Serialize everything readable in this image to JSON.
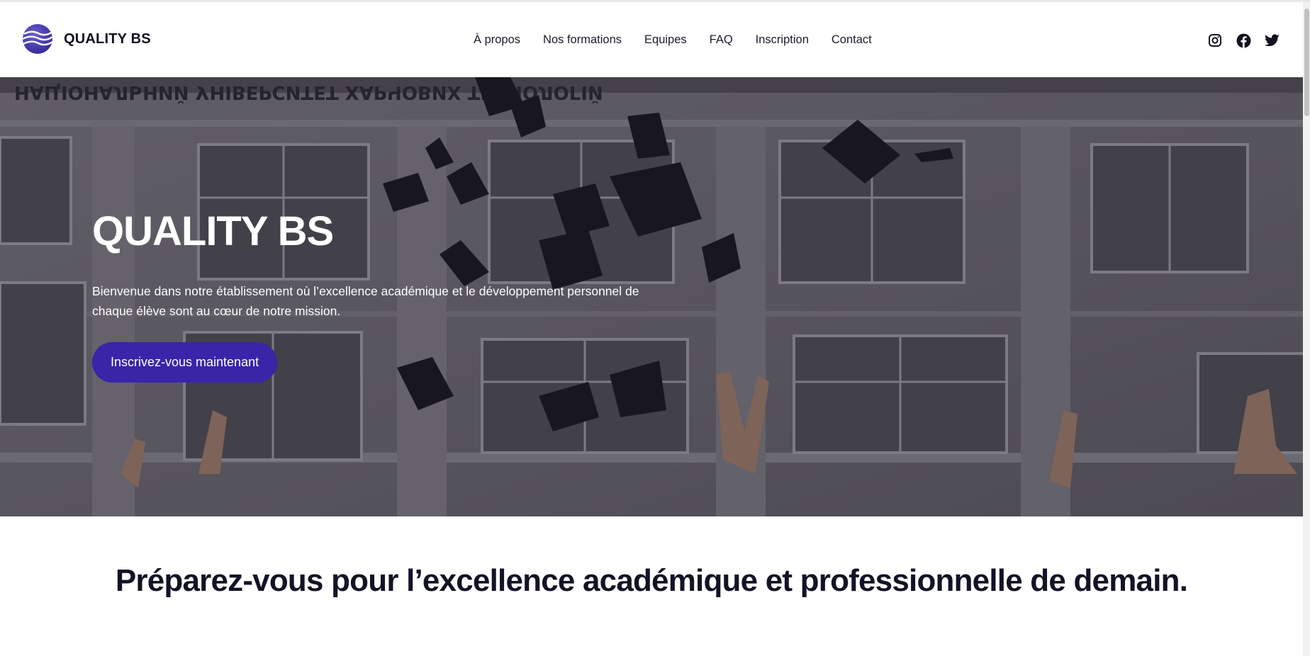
{
  "header": {
    "brand_name": "QUALITY BS",
    "nav": [
      {
        "label": "À propos"
      },
      {
        "label": "Nos formations"
      },
      {
        "label": "Equipes"
      },
      {
        "label": "FAQ"
      },
      {
        "label": "Inscription"
      },
      {
        "label": "Contact"
      }
    ],
    "socials": [
      {
        "icon": "instagram-icon"
      },
      {
        "icon": "facebook-icon"
      },
      {
        "icon": "twitter-icon"
      }
    ]
  },
  "hero": {
    "title": "QUALITY BS",
    "text": "Bienvenue dans notre établissement où l’excellence académique et le développement personnel de chaque élève sont au cœur de notre mission.",
    "cta_label": "Inscrivez-vous maintenant",
    "background_image": "graduation caps thrown in front of university building",
    "building_inscription": "НАЦІОНАЛЬНИЙ УНІВЕРСИТЕТ ХАРЧОВИХ ТЕХНОЛОГІЙ"
  },
  "section": {
    "title": "Préparez-vous pour l’excellence académique et professionnelle de demain."
  },
  "colors": {
    "accent": "#3a24a8",
    "text_dark": "#131326",
    "background": "#ffffff"
  }
}
